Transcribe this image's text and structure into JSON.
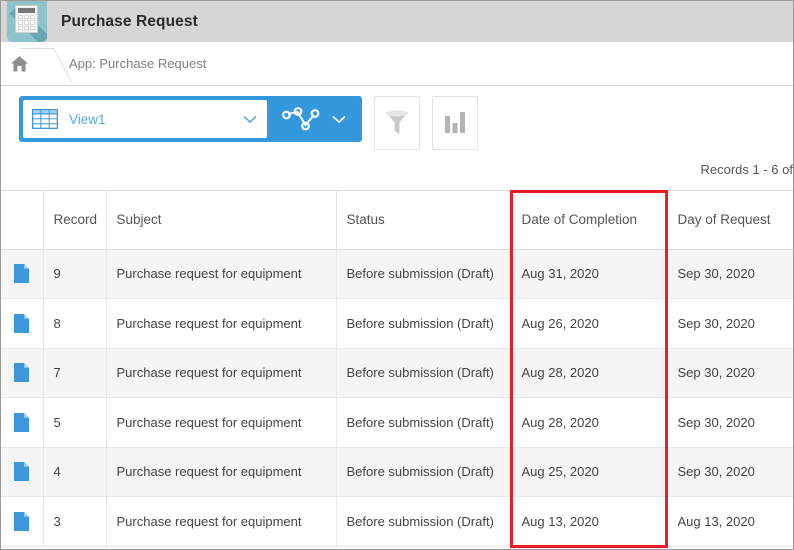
{
  "window": {
    "title": "Purchase Request",
    "app_icon": "calculator-icon"
  },
  "breadcrumb": {
    "home_icon": "home-icon",
    "path": "App: Purchase Request"
  },
  "toolbar": {
    "view_selector": {
      "icon": "table-grid-icon",
      "value": "View1",
      "chevron_icon": "chevron-down-icon"
    },
    "graph_button": {
      "icon": "node-graph-icon",
      "chevron_icon": "chevron-down-icon"
    },
    "filter_button": {
      "icon": "funnel-filter-icon"
    },
    "chart_button": {
      "icon": "bar-chart-icon"
    }
  },
  "records_summary": "Records 1 - 6 of",
  "table": {
    "columns": [
      {
        "key": "icon",
        "label": ""
      },
      {
        "key": "record",
        "label": "Record"
      },
      {
        "key": "subject",
        "label": "Subject"
      },
      {
        "key": "status",
        "label": "Status"
      },
      {
        "key": "date",
        "label": "Date of Completion"
      },
      {
        "key": "day",
        "label": "Day of Request"
      }
    ],
    "rows": [
      {
        "icon": "document-icon",
        "record": "9",
        "subject": "Purchase request for equipment",
        "status": "Before submission (Draft)",
        "date": "Aug 31, 2020",
        "day": "Sep 30, 2020"
      },
      {
        "icon": "document-icon",
        "record": "8",
        "subject": "Purchase request for equipment",
        "status": "Before submission (Draft)",
        "date": "Aug 26, 2020",
        "day": "Sep 30, 2020"
      },
      {
        "icon": "document-icon",
        "record": "7",
        "subject": "Purchase request for equipment",
        "status": "Before submission (Draft)",
        "date": "Aug 28, 2020",
        "day": "Sep 30, 2020"
      },
      {
        "icon": "document-icon",
        "record": "5",
        "subject": "Purchase request for equipment",
        "status": "Before submission (Draft)",
        "date": "Aug 28, 2020",
        "day": "Sep 30, 2020"
      },
      {
        "icon": "document-icon",
        "record": "4",
        "subject": "Purchase request for equipment",
        "status": "Before submission (Draft)",
        "date": "Aug 25, 2020",
        "day": "Sep 30, 2020"
      },
      {
        "icon": "document-icon",
        "record": "3",
        "subject": "Purchase request for equipment",
        "status": "Before submission (Draft)",
        "date": "Aug 13, 2020",
        "day": "Aug 13, 2020"
      }
    ]
  },
  "annotation": {
    "type": "red-rectangle-highlight",
    "target_column": "Date of Completion",
    "color": "#ec1c24"
  },
  "colors": {
    "titlebar": "#d6d6d6",
    "accent_blue": "#3498dd",
    "app_icon_bg": "#8fc3cc",
    "row_stripe": "#f5f5f5",
    "doc_icon": "#3d98db"
  }
}
